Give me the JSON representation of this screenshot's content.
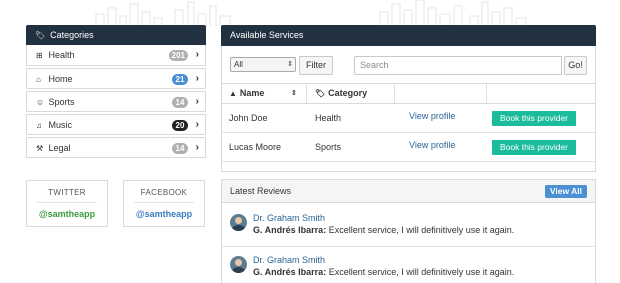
{
  "sidebar": {
    "title": "Categories",
    "items": [
      {
        "label": "Health",
        "count": "201",
        "badge_color": "#b0b0b0",
        "icon": "plus-square-icon"
      },
      {
        "label": "Home",
        "count": "21",
        "badge_color": "#4a90d2",
        "icon": "home-icon"
      },
      {
        "label": "Sports",
        "count": "14",
        "badge_color": "#b0b0b0",
        "icon": "smile-icon"
      },
      {
        "label": "Music",
        "count": "20",
        "badge_color": "#222222",
        "icon": "music-note-icon"
      },
      {
        "label": "Legal",
        "count": "14",
        "badge_color": "#b0b0b0",
        "icon": "gavel-icon"
      }
    ]
  },
  "social": {
    "twitter": {
      "title": "TWITTER",
      "handle": "@samtheapp"
    },
    "facebook": {
      "title": "FACEBOOK",
      "handle": "@samtheapp"
    }
  },
  "services": {
    "title": "Available Services",
    "select_value": "All",
    "filter_label": "Filter",
    "search_placeholder": "Search",
    "go_label": "Go!",
    "columns": [
      "Name",
      "Category"
    ],
    "rows": [
      {
        "name": "John Doe",
        "category": "Health",
        "view": "View profile",
        "book": "Book this provider"
      },
      {
        "name": "Lucas Moore",
        "category": "Sports",
        "view": "View profile",
        "book": "Book this provider"
      }
    ]
  },
  "reviews": {
    "title": "Latest Reviews",
    "view_all": "View All",
    "items": [
      {
        "provider": "Dr. Graham Smith",
        "author": "G. Andrés Ibarra:",
        "text": " Excellent service, I will definitively use it again."
      },
      {
        "provider": "Dr. Graham Smith",
        "author": "G. Andrés Ibarra:",
        "text": " Excellent service, I will definitively use it again."
      }
    ]
  },
  "colors": {
    "header_bg": "#22313f",
    "accent_teal": "#1abc9c",
    "link_blue": "#2a6496",
    "badge_blue": "#4a90d2"
  }
}
